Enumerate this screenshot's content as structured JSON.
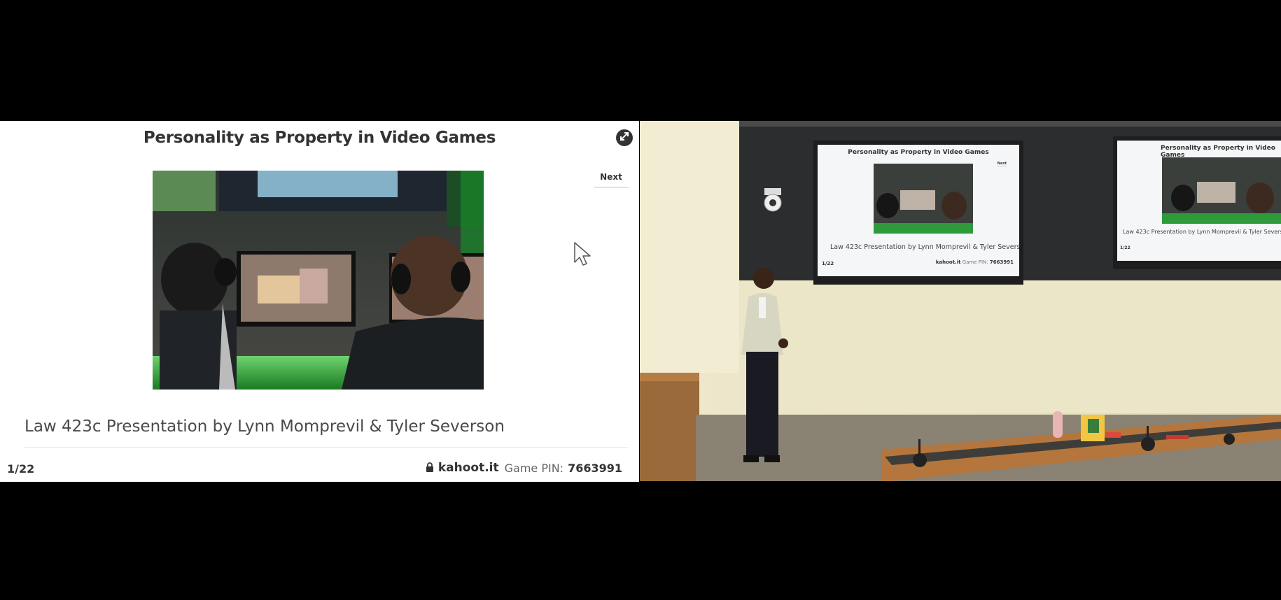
{
  "slide": {
    "title": "Personality as Property in Video Games",
    "next_label": "Next",
    "subtitle": "Law 423c Presentation by Lynn Momprevil & Tyler Severson",
    "counter": "1/22",
    "lock_icon": "lock-icon",
    "site": "kahoot.it",
    "pin_label": "Game PIN:",
    "pin_value": "7663991",
    "fullscreen_icon": "fullscreen-toggle-icon",
    "photo_description": "gamers with headphones at monitors"
  },
  "projection": {
    "title": "Personality as Property in Video Games",
    "subtitle": "Law 423c Presentation by Lynn Momprevil & Tyler Severson",
    "counter": "1/22",
    "site": "kahoot.it",
    "pin_label": "Game PIN:",
    "pin_value": "7663991"
  },
  "colors": {
    "background": "#000000",
    "slide_bg": "#ffffff",
    "text_dark": "#333333",
    "accent_green": "#3fd14a"
  }
}
